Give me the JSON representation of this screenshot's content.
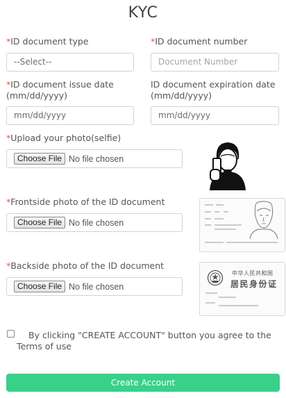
{
  "title": "KYC",
  "required_mark": "*",
  "id_type": {
    "label": "ID document type",
    "value": "--Select--"
  },
  "id_number": {
    "label": "ID document number",
    "placeholder": "Document Number"
  },
  "issue_date": {
    "label": "ID document issue date (mm/dd/yyyy)",
    "placeholder": "mm/dd/yyyy"
  },
  "expiry_date": {
    "label": "ID document expiration date (mm/dd/yyyy)",
    "placeholder": "mm/dd/yyyy"
  },
  "selfie": {
    "label": "Upload your photo(selfie)",
    "button": "Choose File",
    "status": "No file chosen"
  },
  "front": {
    "label": "Frontside photo of the ID document",
    "button": "Choose File",
    "status": "No file chosen"
  },
  "back": {
    "label": "Backside photo of the ID document",
    "button": "Choose File",
    "status": "No file chosen",
    "card_line1": "中华人民共和国",
    "card_line2": "居民身份证"
  },
  "agreement": "By clicking \"CREATE ACCOUNT\" button you agree to the Terms of use",
  "create_button": "Create Account",
  "colors": {
    "accent": "#39d08a",
    "required": "#e05b3c"
  },
  "icons": [
    "person-selfie-icon",
    "id-card-front-icon",
    "id-card-back-icon",
    "emblem-icon"
  ]
}
